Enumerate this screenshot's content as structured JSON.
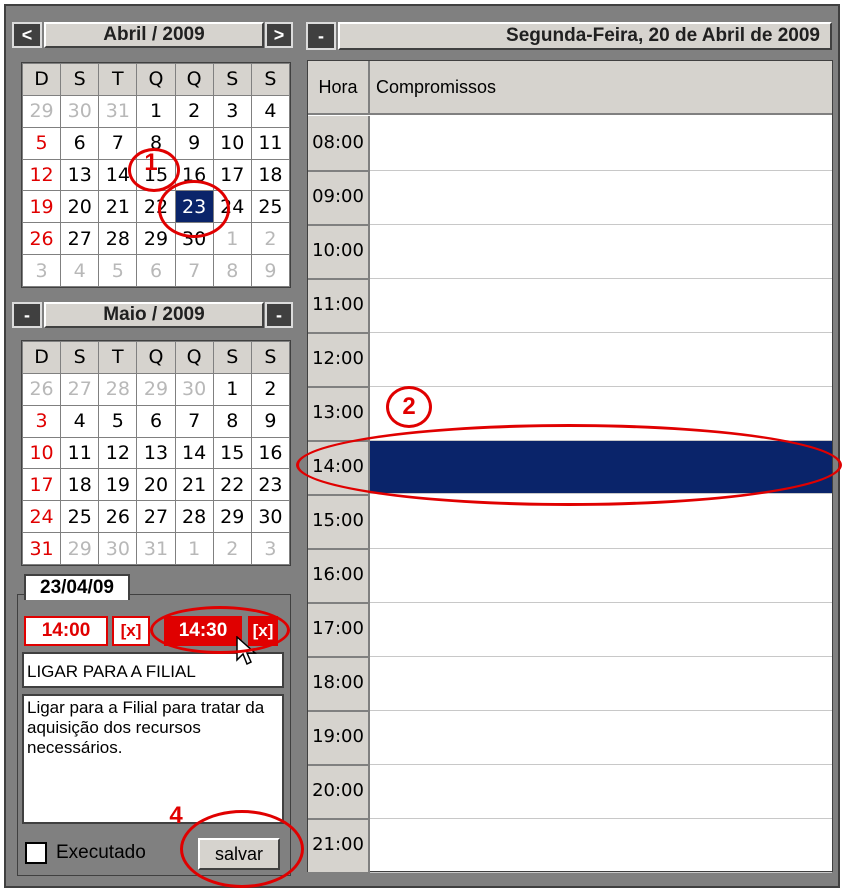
{
  "april": {
    "title": "Abril / 2009",
    "prev_icon": "chevron-left-icon",
    "next_icon": "chevron-right-icon",
    "prev_glyph": "<",
    "next_glyph": ">",
    "headers": [
      "D",
      "S",
      "T",
      "Q",
      "Q",
      "S",
      "S"
    ],
    "weeks": [
      [
        "29",
        "30",
        "31",
        "1",
        "2",
        "3",
        "4"
      ],
      [
        "5",
        "6",
        "7",
        "8",
        "9",
        "10",
        "11"
      ],
      [
        "12",
        "13",
        "14",
        "15",
        "16",
        "17",
        "18"
      ],
      [
        "19",
        "20",
        "21",
        "22",
        "23",
        "24",
        "25"
      ],
      [
        "26",
        "27",
        "28",
        "29",
        "30",
        "1",
        "2"
      ],
      [
        "3",
        "4",
        "5",
        "6",
        "7",
        "8",
        "9"
      ]
    ],
    "other_month": [
      [
        1,
        1,
        1,
        0,
        0,
        0,
        0
      ],
      [
        0,
        0,
        0,
        0,
        0,
        0,
        0
      ],
      [
        0,
        0,
        0,
        0,
        0,
        0,
        0
      ],
      [
        0,
        0,
        0,
        0,
        0,
        0,
        0
      ],
      [
        0,
        0,
        0,
        0,
        0,
        1,
        1
      ],
      [
        1,
        1,
        1,
        1,
        1,
        1,
        1
      ]
    ],
    "selected_day": "23"
  },
  "may": {
    "title": "Maio / 2009",
    "collapse_left": "-",
    "collapse_right": "-",
    "headers": [
      "D",
      "S",
      "T",
      "Q",
      "Q",
      "S",
      "S"
    ],
    "weeks": [
      [
        "26",
        "27",
        "28",
        "29",
        "30",
        "1",
        "2"
      ],
      [
        "3",
        "4",
        "5",
        "6",
        "7",
        "8",
        "9"
      ],
      [
        "10",
        "11",
        "12",
        "13",
        "14",
        "15",
        "16"
      ],
      [
        "17",
        "18",
        "19",
        "20",
        "21",
        "22",
        "23"
      ],
      [
        "24",
        "25",
        "26",
        "27",
        "28",
        "29",
        "30"
      ],
      [
        "31",
        "29",
        "30",
        "31",
        "1",
        "2",
        "3"
      ]
    ],
    "other_month": [
      [
        1,
        1,
        1,
        1,
        1,
        0,
        0
      ],
      [
        0,
        0,
        0,
        0,
        0,
        0,
        0
      ],
      [
        0,
        0,
        0,
        0,
        0,
        0,
        0
      ],
      [
        0,
        0,
        0,
        0,
        0,
        0,
        0
      ],
      [
        0,
        0,
        0,
        0,
        0,
        0,
        0
      ],
      [
        0,
        1,
        1,
        1,
        1,
        1,
        1
      ]
    ]
  },
  "editor": {
    "date": "23/04/09",
    "start_time": "14:00",
    "start_clear": "[x]",
    "end_time": "14:30",
    "end_clear": "[x]",
    "subject": "LIGAR PARA A FILIAL",
    "description": "Ligar para a Filial para tratar da aquisição dos recursos necessários.",
    "executed_label": "Executado",
    "save_label": "salvar"
  },
  "day_view": {
    "collapse": "-",
    "title": "Segunda-Feira, 20 de Abril de 2009",
    "col_hour": "Hora",
    "col_appointments": "Compromissos",
    "hours": [
      "08:00",
      "09:00",
      "10:00",
      "11:00",
      "12:00",
      "13:00",
      "14:00",
      "15:00",
      "16:00",
      "17:00",
      "18:00",
      "19:00",
      "20:00",
      "21:00"
    ],
    "selected_hour": "14:00",
    "selected_color": "#0a246a"
  },
  "annotations": [
    "1",
    "2",
    "4"
  ],
  "colors": {
    "accent_red": "#e00000",
    "selection_navy": "#0a246a",
    "panel_gray": "#808080"
  }
}
